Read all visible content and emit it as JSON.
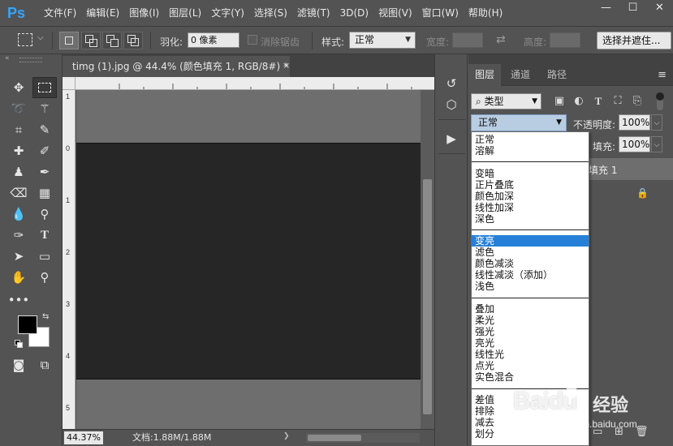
{
  "app": {
    "logo": "Ps",
    "menu": [
      "文件(F)",
      "编辑(E)",
      "图像(I)",
      "图层(L)",
      "文字(Y)",
      "选择(S)",
      "滤镜(T)",
      "3D(D)",
      "视图(V)",
      "窗口(W)",
      "帮助(H)"
    ],
    "window_buttons": [
      "—",
      "☐",
      "✕"
    ]
  },
  "options_bar": {
    "feather_label": "羽化:",
    "feather_value": "0 像素",
    "antialias_label": "消除锯齿",
    "style_label": "样式:",
    "style_value": "正常",
    "width_label": "宽度:",
    "height_label": "高度:",
    "select_mask_button": "选择并遮住..."
  },
  "document": {
    "tab_title": "timg (1).jpg @ 44.4% (颜色填充 1, RGB/8#) *",
    "tab_close": "×",
    "zoom": "44.37%",
    "info": "文档:1.88M/1.88M",
    "ruler_left_numbers": [
      "1",
      "0",
      "1",
      "2",
      "3",
      "4",
      "5"
    ],
    "colors": {
      "canvas_bg": "#6e6e6e",
      "image": "#262626"
    }
  },
  "layers_panel": {
    "tabs": [
      "图层",
      "通道",
      "路径"
    ],
    "filter_value": "类型",
    "blend_mode": "正常",
    "opacity_label": "不透明度:",
    "opacity_value": "100%",
    "fill_label": "填充:",
    "fill_value": "100%",
    "layer_name": "填充 1"
  },
  "blend_modes": {
    "groups": [
      [
        "正常",
        "溶解"
      ],
      [
        "变暗",
        "正片叠底",
        "颜色加深",
        "线性加深",
        "深色"
      ],
      [
        "变亮",
        "滤色",
        "颜色减淡",
        "线性减淡（添加）",
        "浅色"
      ],
      [
        "叠加",
        "柔光",
        "强光",
        "亮光",
        "线性光",
        "点光",
        "实色混合"
      ],
      [
        "差值",
        "排除",
        "减去",
        "划分"
      ]
    ],
    "selected": "变亮",
    "selected_color": "#2680d8"
  },
  "watermark": {
    "brand": "Baidu",
    "cn": "经验",
    "url": "jingyan.baidu.com"
  }
}
